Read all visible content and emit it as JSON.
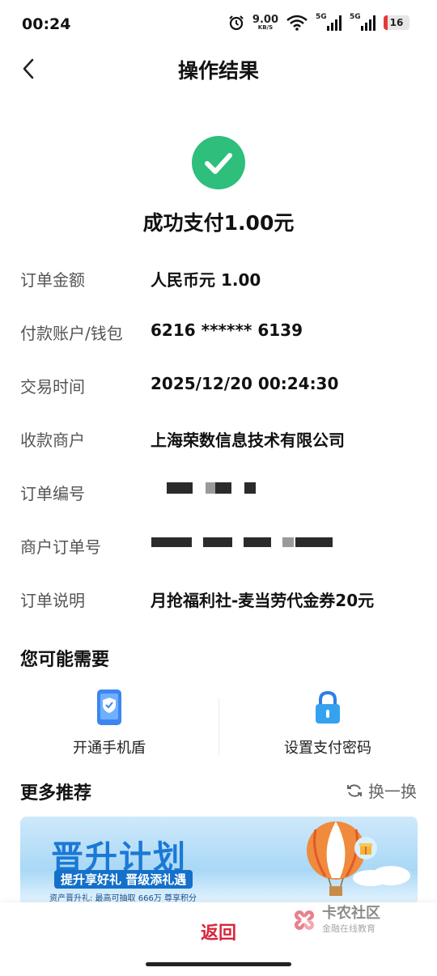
{
  "status_bar": {
    "time": "00:24",
    "net_speed": "9.00",
    "net_unit": "KB/S",
    "sim1": "5G",
    "sim2": "5G",
    "battery": "16"
  },
  "header": {
    "title": "操作结果"
  },
  "result": {
    "message": "成功支付1.00元",
    "accent": "#2dbf7b"
  },
  "details": [
    {
      "label": "订单金额",
      "value": "人民币元 1.00"
    },
    {
      "label": "付款账户/钱包",
      "value": "6216 ****** 6139"
    },
    {
      "label": "交易时间",
      "value": "2025/12/20 00:24:30"
    },
    {
      "label": "收款商户",
      "value": "上海荣数信息技术有限公司"
    },
    {
      "label": "订单编号",
      "value": ""
    },
    {
      "label": "商户订单号",
      "value": ""
    },
    {
      "label": "订单说明",
      "value": "月抢福利社-麦当劳代金券20元"
    }
  ],
  "you_may_need": {
    "title": "您可能需要",
    "items": [
      {
        "label": "开通手机盾",
        "icon": "phone-shield-icon"
      },
      {
        "label": "设置支付密码",
        "icon": "lock-icon"
      }
    ]
  },
  "recommend": {
    "title": "更多推荐",
    "refresh_label": "换一换",
    "banner": {
      "title": "晋升计划",
      "subtitle": "提升享好礼 晋级添礼遇",
      "small": "资产晋升礼: 最高可抽取 666万 尊享积分"
    }
  },
  "bottom": {
    "return_label": "返回",
    "return_color": "#d8243a",
    "watermark_main": "卡农社区",
    "watermark_sub": "金融在线教育"
  }
}
